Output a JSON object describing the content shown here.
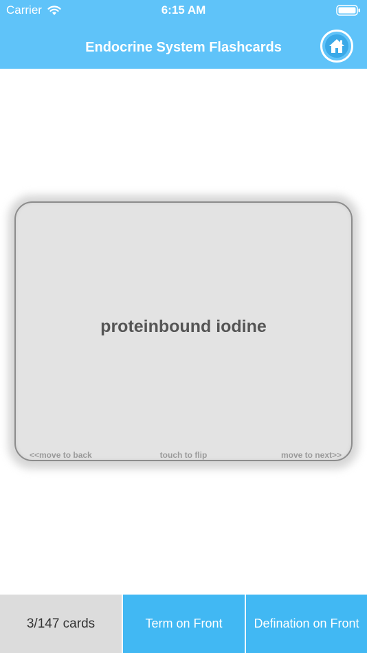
{
  "status_bar": {
    "carrier": "Carrier",
    "time": "6:15 AM",
    "icons": [
      "wifi-icon",
      "battery-icon"
    ]
  },
  "nav": {
    "title": "Endocrine System Flashcards",
    "home_icon": "home-icon"
  },
  "card": {
    "term": "proteinbound iodine",
    "hint_back": "<<move to back",
    "hint_flip": "touch to flip",
    "hint_next": "move to next>>"
  },
  "bottom": {
    "count": "3/147 cards",
    "term_on_front": "Term on Front",
    "definition_on_front": "Defination on Front"
  },
  "colors": {
    "header": "#5fc3f9",
    "button": "#41b8f3",
    "count_bg": "#dcdcdc",
    "card_bg": "#e3e3e3"
  }
}
